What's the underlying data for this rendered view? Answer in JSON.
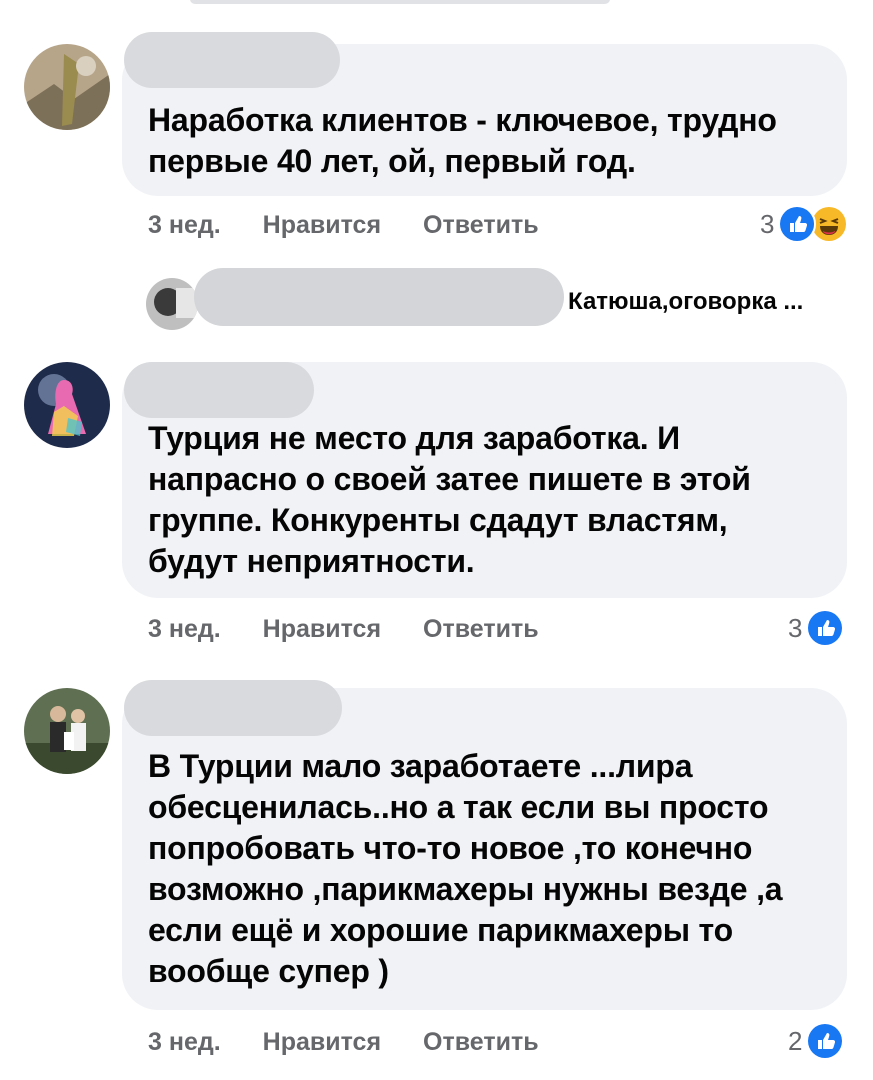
{
  "comments": [
    {
      "text": "Наработка клиентов - ключевое, трудно первые 40 лет, ой, первый год.",
      "time": "3 нед.",
      "like": "Нравится",
      "reply": "Ответить",
      "reactions": {
        "count": "3",
        "icons": [
          "like-icon",
          "haha-icon"
        ]
      }
    },
    {
      "text": "Турция не место для заработка. И напрасно о своей затее пишете в этой группе. Конкуренты сдадут властям, будут неприятности.",
      "time": "3 нед.",
      "like": "Нравится",
      "reply": "Ответить",
      "reactions": {
        "count": "3",
        "icons": [
          "like-icon"
        ]
      }
    },
    {
      "text": "В Турции мало заработаете ...лира обесценилась..но а так если вы просто попробовать что-то новое ,то конечно возможно ,парикмахеры нужны везде ,а если ещё и хорошие парикмахеры то вообще супер )",
      "time": "3 нед.",
      "like": "Нравится",
      "reply": "Ответить",
      "reactions": {
        "count": "2",
        "icons": [
          "like-icon"
        ]
      }
    }
  ],
  "reply_preview": {
    "text": "Катюша,оговорка ..."
  },
  "colors": {
    "like_blue": "#1877f2",
    "bubble": "#f0f2f5",
    "meta_gray": "#65676b",
    "haha_yellow": "#f7b928"
  }
}
